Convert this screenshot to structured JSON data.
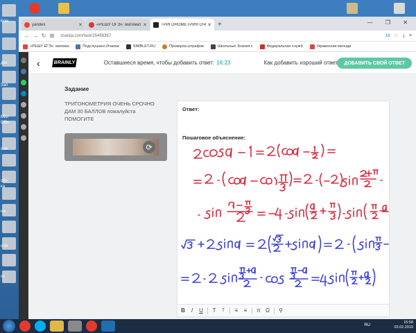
{
  "desktop": {
    "labels": [
      "Ком",
      "дск",
      "Зап",
      "Micr",
      "Offic",
      "оли",
      "сбо",
      "ка",
      "на",
      "оли",
      "сс"
    ]
  },
  "browser": {
    "tabs": [
      {
        "title": "yandex",
        "active": false,
        "color": "#e8433a"
      },
      {
        "title": "«РЕШУ ОГЭ»: математи",
        "active": false,
        "color": "#d23c3c"
      },
      {
        "title": "ТРИГОНОМЕТРИЯ ОЧЕН",
        "active": true,
        "color": "#222"
      }
    ],
    "new_tab": "+",
    "window_controls": "— ❐ ✕",
    "url": "znanija.com/task/25456387",
    "ext_badge": "18",
    "bookmarks": [
      {
        "label": "«РЕШУ ЕГЭ»: матема",
        "color": "#e8433a"
      },
      {
        "label": "Подслушано Ичалки",
        "color": "#4a76a8"
      },
      {
        "label": "SIMBLET.RU",
        "color": "#333"
      },
      {
        "label": "Проверка штрафов",
        "color": "#cc7a22"
      },
      {
        "label": "Школьные Знания.c",
        "color": "#444"
      },
      {
        "label": "Федеральная служб",
        "color": "#c9302c"
      },
      {
        "label": "Украинские мелоди",
        "color": "#d04a4a"
      }
    ]
  },
  "header": {
    "logo": "BRAINLY",
    "time_text": "Оставшееся время, чтобы добавить ответ:",
    "time_value": "16:23",
    "howto": "Как добавить хороший ответ",
    "add_button": "ДОБАВИТЬ СВОЙ ОТВЕТ"
  },
  "task": {
    "label": "Задание",
    "text": "ТРИГОНОМЕТРИЯ ОЧЕНЬ СРОЧНО ДАМ 30 БАЛЛОВ пожалуйста ПОМОГИТЕ"
  },
  "editor": {
    "answer_label": "Ответ:",
    "step_label": "Пошаговое объяснение:",
    "toolbar": [
      "B",
      "I",
      "U",
      "T",
      "T",
      "≡",
      "≡",
      "π",
      "Ω",
      "⚲"
    ]
  },
  "taskbar": {
    "lang": "RU",
    "time": "15:58",
    "date": "03.02.2019"
  },
  "colors": {
    "accent_green": "#5ec8a3",
    "time_teal": "#44c0b6",
    "ink_red": "#d8263a",
    "ink_blue": "#3b3fd4"
  }
}
